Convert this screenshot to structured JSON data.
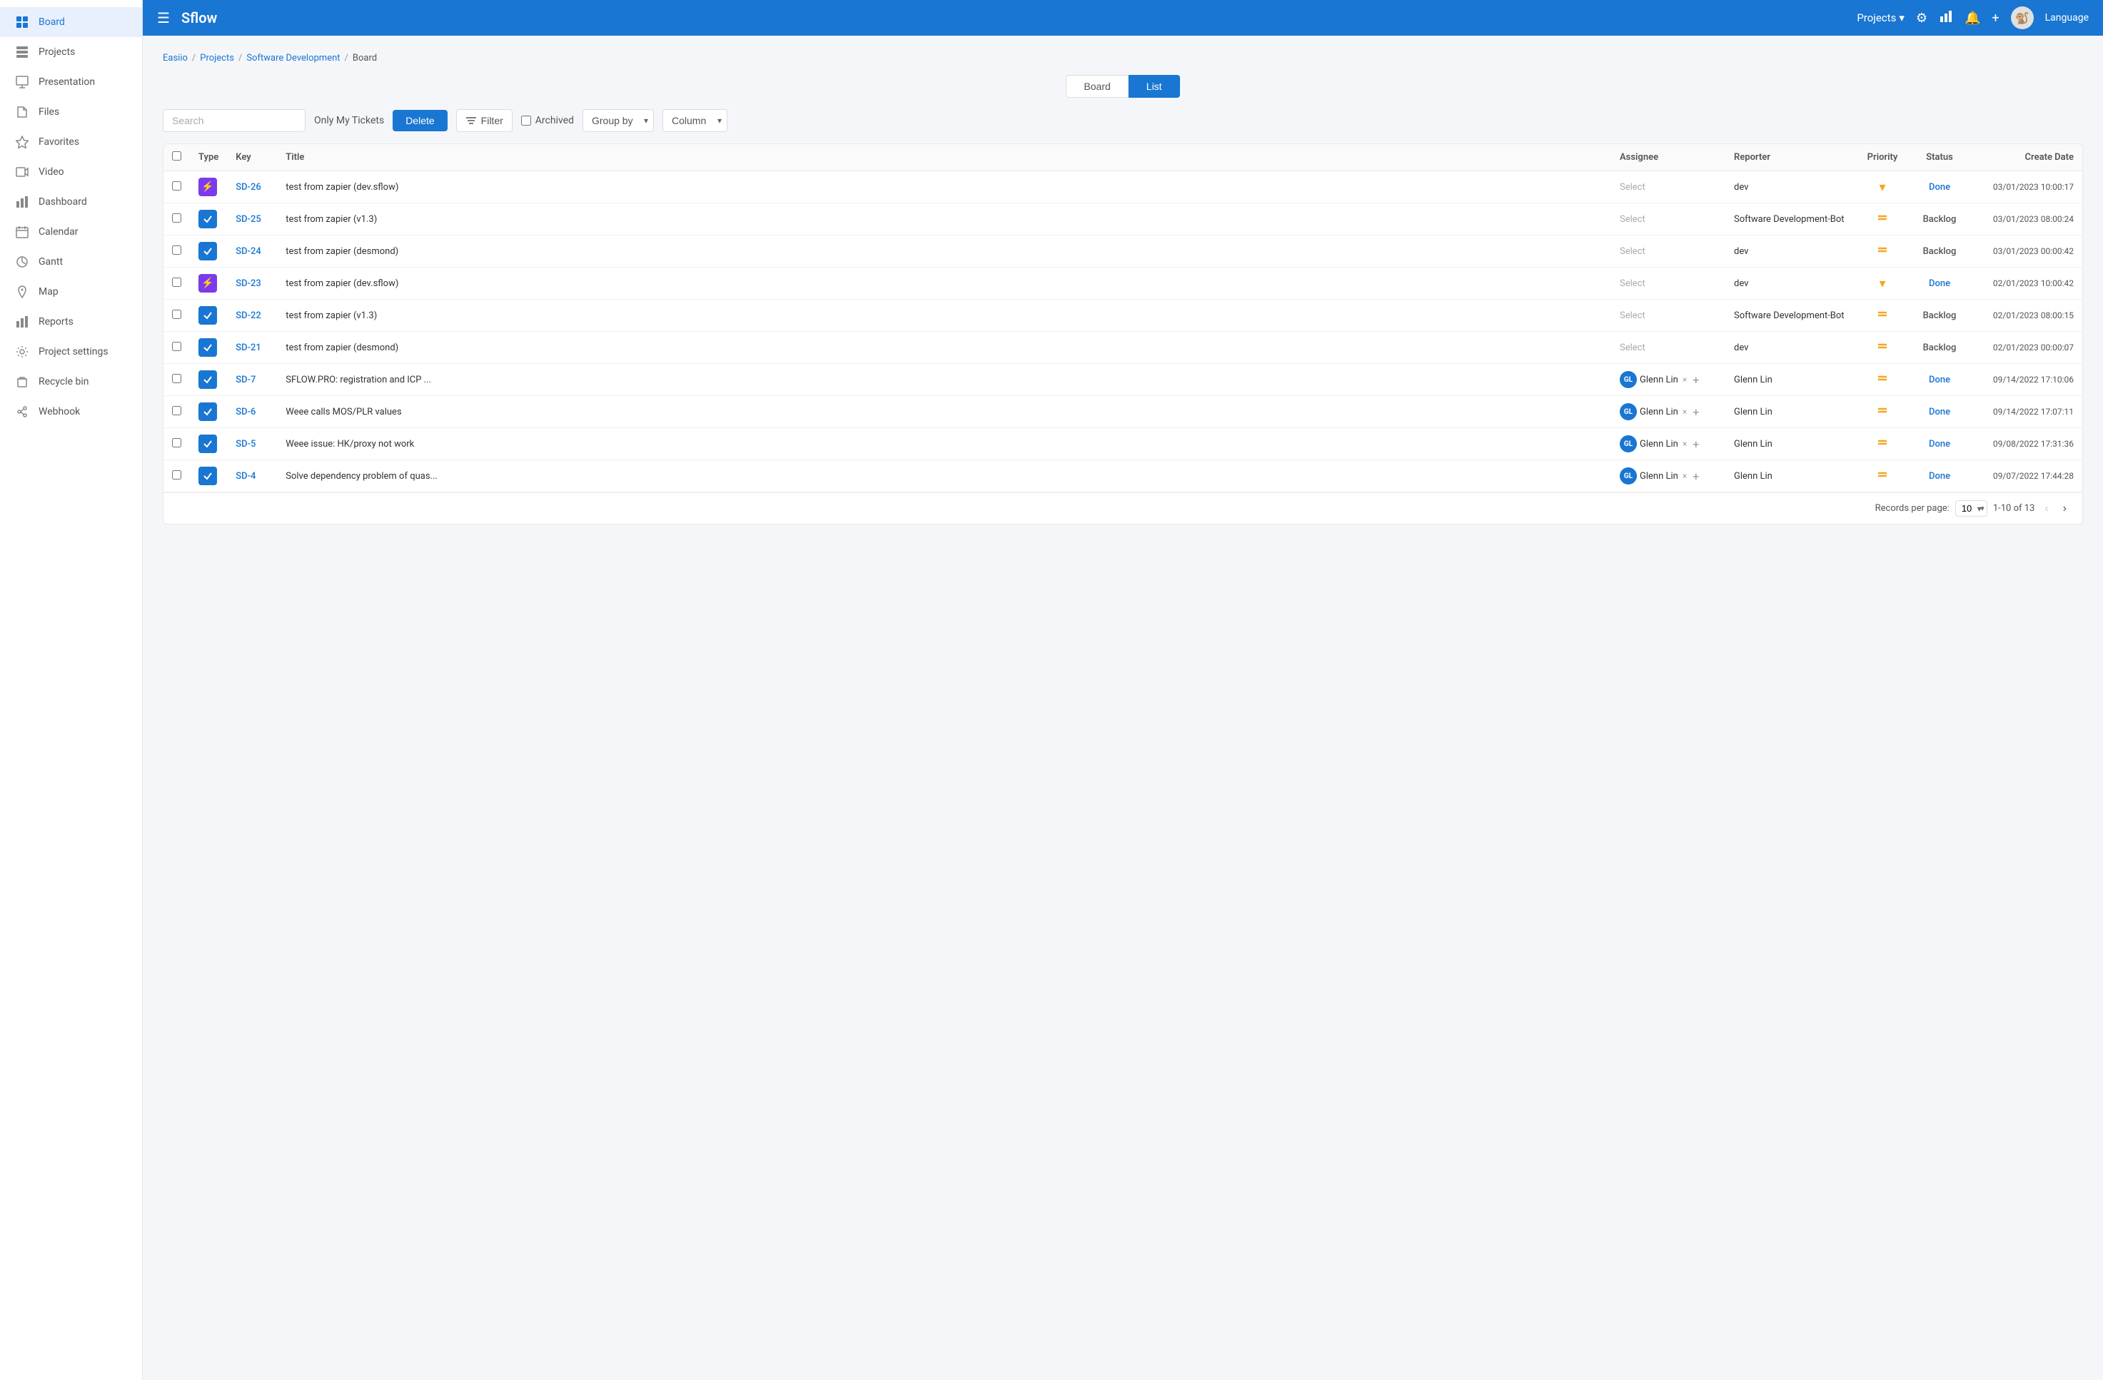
{
  "app": {
    "logo": "Sflow",
    "language": "Language"
  },
  "topnav": {
    "projects_label": "Projects",
    "language": "Language"
  },
  "sidebar": {
    "items": [
      {
        "id": "board",
        "label": "Board",
        "active": true
      },
      {
        "id": "projects",
        "label": "Projects",
        "active": false
      },
      {
        "id": "presentation",
        "label": "Presentation",
        "active": false
      },
      {
        "id": "files",
        "label": "Files",
        "active": false
      },
      {
        "id": "favorites",
        "label": "Favorites",
        "active": false
      },
      {
        "id": "video",
        "label": "Video",
        "active": false
      },
      {
        "id": "dashboard",
        "label": "Dashboard",
        "active": false
      },
      {
        "id": "calendar",
        "label": "Calendar",
        "active": false
      },
      {
        "id": "gantt",
        "label": "Gantt",
        "active": false
      },
      {
        "id": "map",
        "label": "Map",
        "active": false
      },
      {
        "id": "reports",
        "label": "Reports",
        "active": false
      },
      {
        "id": "project-settings",
        "label": "Project settings",
        "active": false
      },
      {
        "id": "recycle-bin",
        "label": "Recycle bin",
        "active": false
      },
      {
        "id": "webhook",
        "label": "Webhook",
        "active": false
      }
    ]
  },
  "breadcrumb": {
    "items": [
      "Easiio",
      "Projects",
      "Software Development",
      "Board"
    ]
  },
  "view_toggle": {
    "board": "Board",
    "list": "List"
  },
  "toolbar": {
    "search_placeholder": "Search",
    "only_my_tickets": "Only My Tickets",
    "delete_label": "Delete",
    "filter_label": "Filter",
    "archived_label": "Archived",
    "groupby_label": "Group by",
    "column_label": "Column"
  },
  "table": {
    "headers": [
      "",
      "Type",
      "Key",
      "Title",
      "Assignee",
      "Reporter",
      "Priority",
      "Status",
      "Create Date"
    ],
    "rows": [
      {
        "key": "SD-26",
        "type": "lightning",
        "title": "test from zapier (dev.sflow)",
        "assignee": null,
        "reporter": "dev",
        "priority": "dropdown",
        "status": "Done",
        "status_type": "done",
        "date": "03/01/2023 10:00:17",
        "checked": false
      },
      {
        "key": "SD-25",
        "type": "check",
        "title": "test from zapier (v1.3)",
        "assignee": null,
        "reporter": "Software Development-Bot",
        "priority": "medium",
        "status": "Backlog",
        "status_type": "backlog",
        "date": "03/01/2023 08:00:24",
        "checked": false
      },
      {
        "key": "SD-24",
        "type": "check",
        "title": "test from zapier (desmond)",
        "assignee": null,
        "reporter": "dev",
        "priority": "medium",
        "status": "Backlog",
        "status_type": "backlog",
        "date": "03/01/2023 00:00:42",
        "checked": false
      },
      {
        "key": "SD-23",
        "type": "lightning",
        "title": "test from zapier (dev.sflow)",
        "assignee": null,
        "reporter": "dev",
        "priority": "dropdown",
        "status": "Done",
        "status_type": "done",
        "date": "02/01/2023 10:00:42",
        "checked": false
      },
      {
        "key": "SD-22",
        "type": "check",
        "title": "test from zapier (v1.3)",
        "assignee": null,
        "reporter": "Software Development-Bot",
        "priority": "medium",
        "status": "Backlog",
        "status_type": "backlog",
        "date": "02/01/2023 08:00:15",
        "checked": false
      },
      {
        "key": "SD-21",
        "type": "check",
        "title": "test from zapier (desmond)",
        "assignee": null,
        "reporter": "dev",
        "priority": "medium",
        "status": "Backlog",
        "status_type": "backlog",
        "date": "02/01/2023 00:00:07",
        "checked": false
      },
      {
        "key": "SD-7",
        "type": "check",
        "title": "SFLOW.PRO: registration and ICP ...",
        "assignee": "Glenn Lin",
        "reporter": "Glenn Lin",
        "priority": "medium",
        "status": "Done",
        "status_type": "done",
        "date": "09/14/2022 17:10:06",
        "checked": false
      },
      {
        "key": "SD-6",
        "type": "check",
        "title": "Weee calls MOS/PLR values",
        "assignee": "Glenn Lin",
        "reporter": "Glenn Lin",
        "priority": "medium",
        "status": "Done",
        "status_type": "done",
        "date": "09/14/2022 17:07:11",
        "checked": false
      },
      {
        "key": "SD-5",
        "type": "check",
        "title": "Weee issue: HK/proxy not work",
        "assignee": "Glenn Lin",
        "reporter": "Glenn Lin",
        "priority": "medium",
        "status": "Done",
        "status_type": "done",
        "date": "09/08/2022 17:31:36",
        "checked": false
      },
      {
        "key": "SD-4",
        "type": "check",
        "title": "Solve dependency problem of quas...",
        "assignee": "Glenn Lin",
        "reporter": "Glenn Lin",
        "priority": "medium",
        "status": "Done",
        "status_type": "done",
        "date": "09/07/2022 17:44:28",
        "checked": false
      }
    ]
  },
  "pagination": {
    "records_per_page_label": "Records per page:",
    "per_page": "10",
    "range": "1-10 of 13"
  }
}
